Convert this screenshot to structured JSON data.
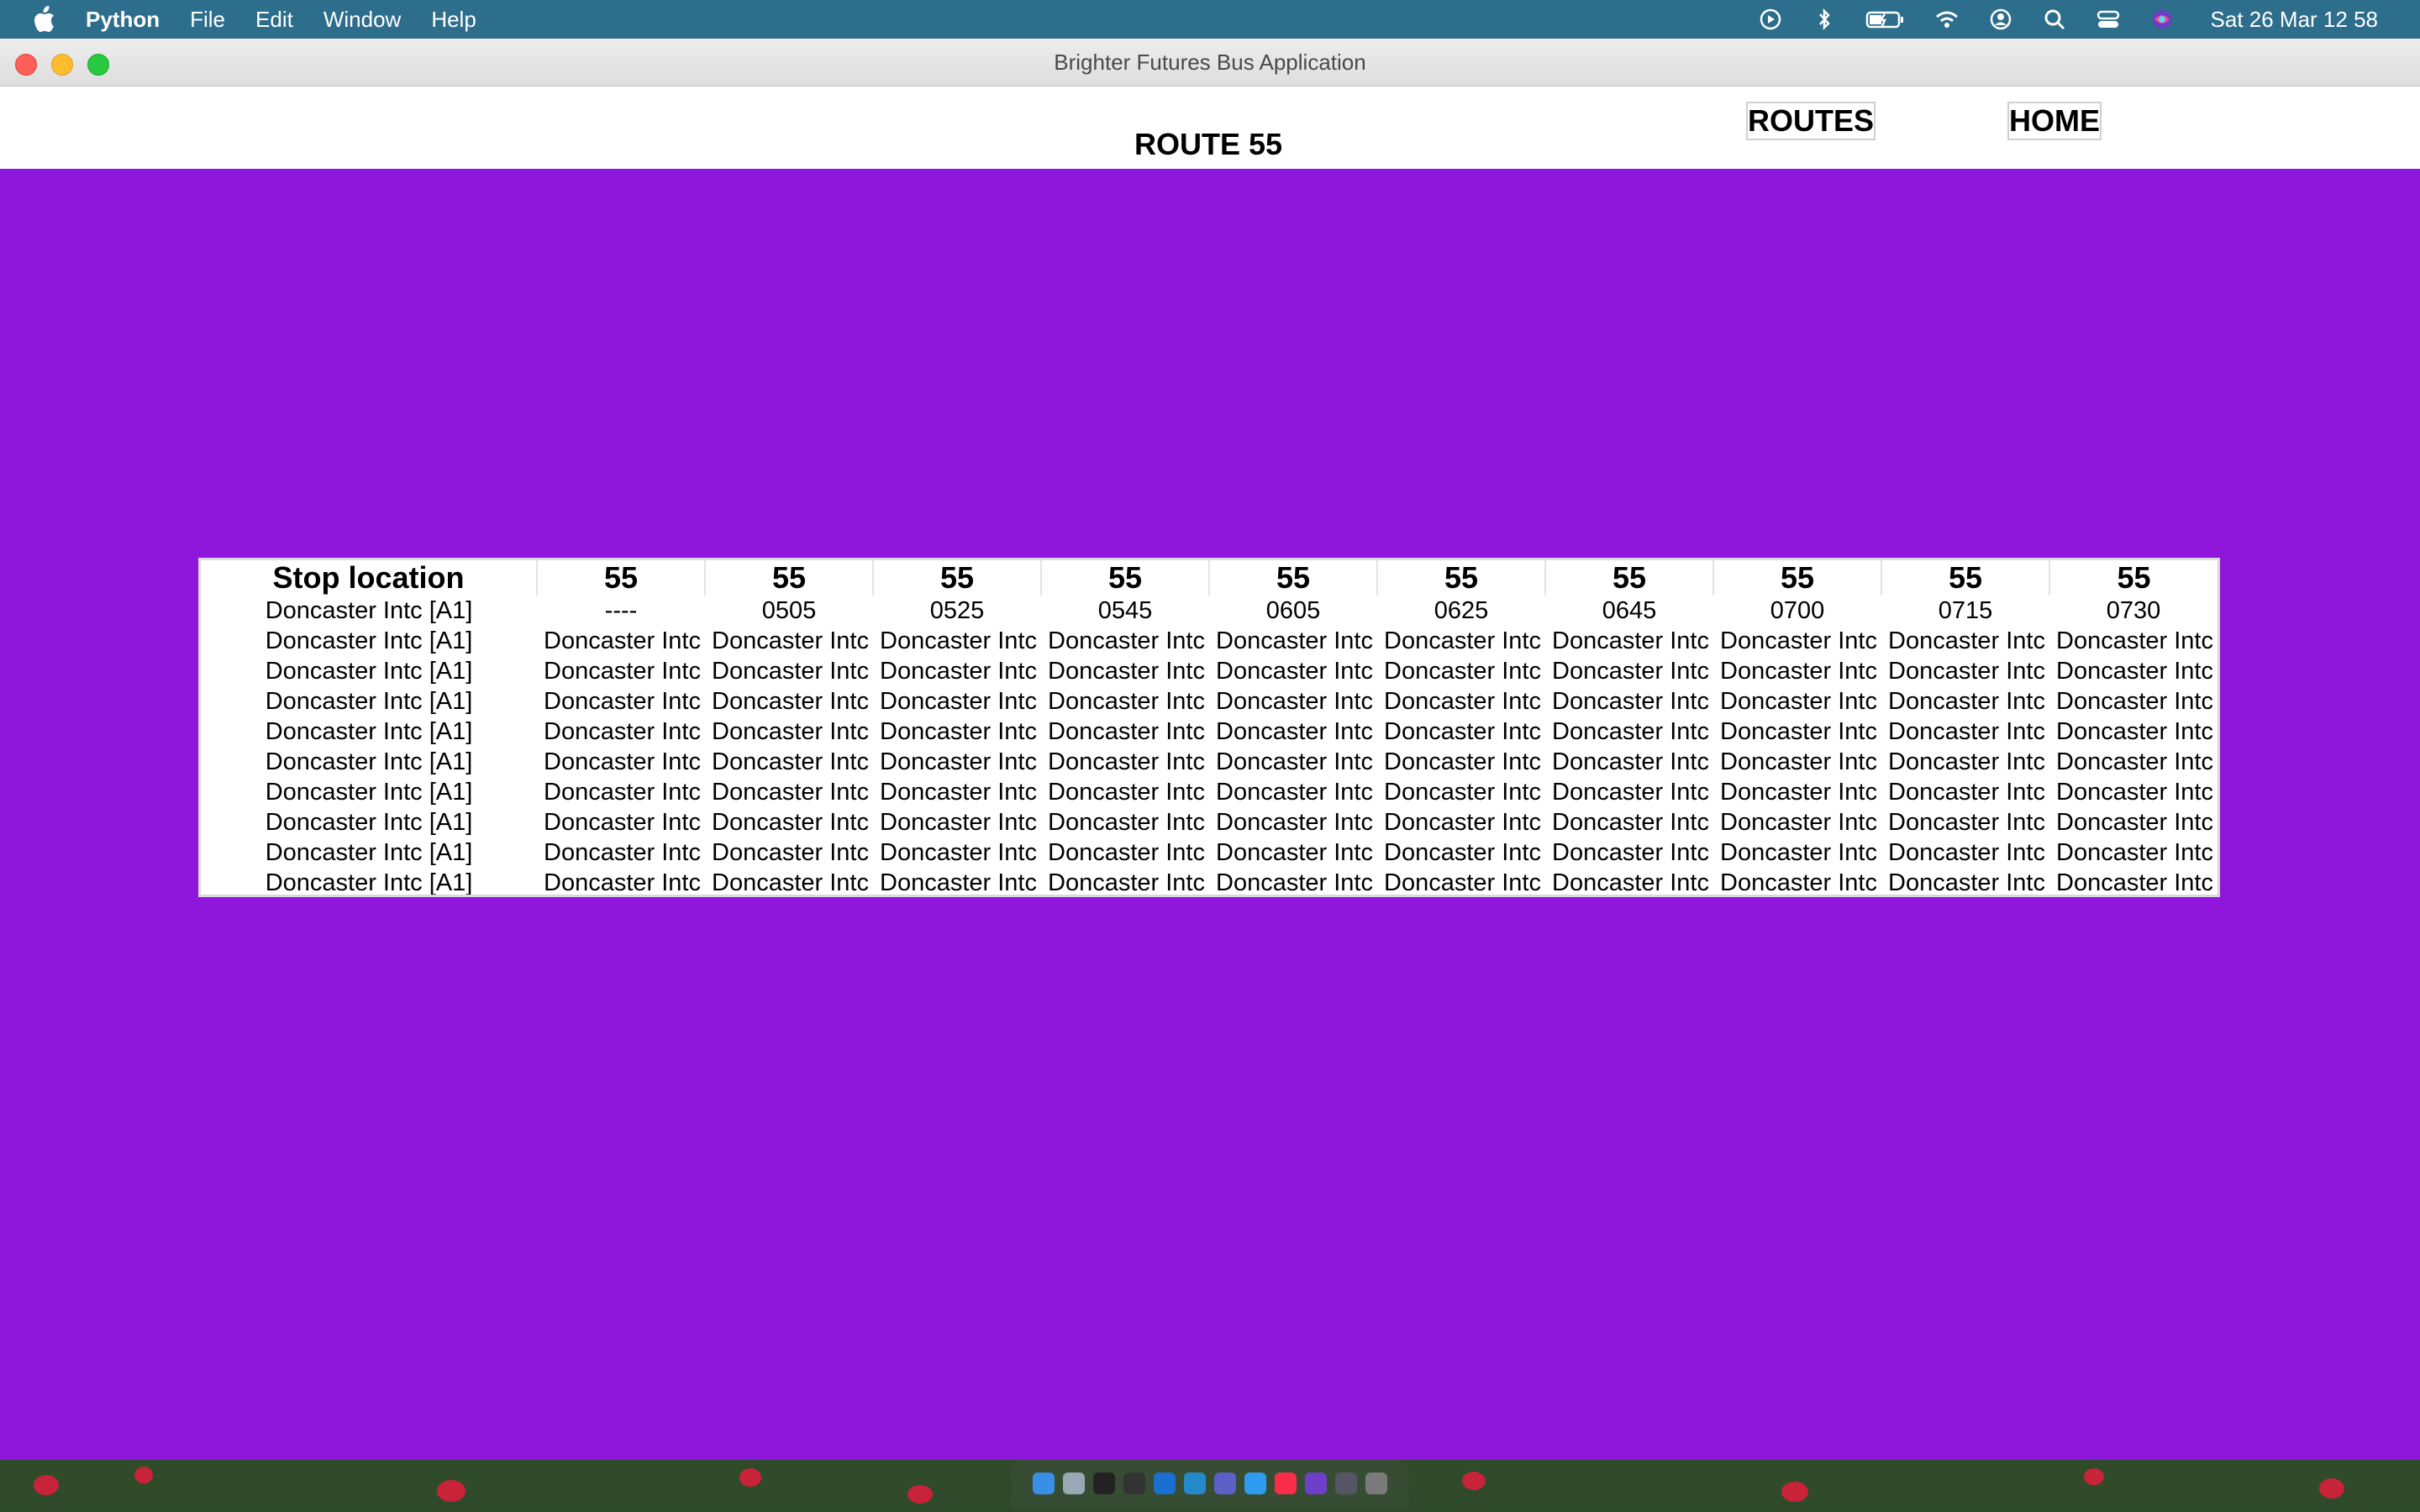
{
  "menubar": {
    "app_name": "Python",
    "items": [
      "File",
      "Edit",
      "Window",
      "Help"
    ],
    "clock": "Sat 26 Mar  12 58"
  },
  "window": {
    "title": "Brighter Futures Bus Application"
  },
  "header": {
    "page_title": "ROUTE 55",
    "routes_button": "ROUTES",
    "home_button": "HOME"
  },
  "timetable": {
    "columns": [
      "Stop location",
      "55",
      "55",
      "55",
      "55",
      "55",
      "55",
      "55",
      "55",
      "55",
      "55"
    ],
    "rows": [
      [
        "Doncaster Intc [A1]",
        "----",
        "0505",
        "0525",
        "0545",
        "0605",
        "0625",
        "0645",
        "0700",
        "0715",
        "0730"
      ],
      [
        "Doncaster Intc [A1]",
        "Doncaster Intc",
        "Doncaster Intc",
        "Doncaster Intc",
        "Doncaster Intc",
        "Doncaster Intc",
        "Doncaster Intc",
        "Doncaster Intc",
        "Doncaster Intc",
        "Doncaster Intc",
        "Doncaster Intc"
      ],
      [
        "Doncaster Intc [A1]",
        "Doncaster Intc",
        "Doncaster Intc",
        "Doncaster Intc",
        "Doncaster Intc",
        "Doncaster Intc",
        "Doncaster Intc",
        "Doncaster Intc",
        "Doncaster Intc",
        "Doncaster Intc",
        "Doncaster Intc"
      ],
      [
        "Doncaster Intc [A1]",
        "Doncaster Intc",
        "Doncaster Intc",
        "Doncaster Intc",
        "Doncaster Intc",
        "Doncaster Intc",
        "Doncaster Intc",
        "Doncaster Intc",
        "Doncaster Intc",
        "Doncaster Intc",
        "Doncaster Intc"
      ],
      [
        "Doncaster Intc [A1]",
        "Doncaster Intc",
        "Doncaster Intc",
        "Doncaster Intc",
        "Doncaster Intc",
        "Doncaster Intc",
        "Doncaster Intc",
        "Doncaster Intc",
        "Doncaster Intc",
        "Doncaster Intc",
        "Doncaster Intc"
      ],
      [
        "Doncaster Intc [A1]",
        "Doncaster Intc",
        "Doncaster Intc",
        "Doncaster Intc",
        "Doncaster Intc",
        "Doncaster Intc",
        "Doncaster Intc",
        "Doncaster Intc",
        "Doncaster Intc",
        "Doncaster Intc",
        "Doncaster Intc"
      ],
      [
        "Doncaster Intc [A1]",
        "Doncaster Intc",
        "Doncaster Intc",
        "Doncaster Intc",
        "Doncaster Intc",
        "Doncaster Intc",
        "Doncaster Intc",
        "Doncaster Intc",
        "Doncaster Intc",
        "Doncaster Intc",
        "Doncaster Intc"
      ],
      [
        "Doncaster Intc [A1]",
        "Doncaster Intc",
        "Doncaster Intc",
        "Doncaster Intc",
        "Doncaster Intc",
        "Doncaster Intc",
        "Doncaster Intc",
        "Doncaster Intc",
        "Doncaster Intc",
        "Doncaster Intc",
        "Doncaster Intc"
      ],
      [
        "Doncaster Intc [A1]",
        "Doncaster Intc",
        "Doncaster Intc",
        "Doncaster Intc",
        "Doncaster Intc",
        "Doncaster Intc",
        "Doncaster Intc",
        "Doncaster Intc",
        "Doncaster Intc",
        "Doncaster Intc",
        "Doncaster Intc"
      ],
      [
        "Doncaster Intc [A1]",
        "Doncaster Intc",
        "Doncaster Intc",
        "Doncaster Intc",
        "Doncaster Intc",
        "Doncaster Intc",
        "Doncaster Intc",
        "Doncaster Intc",
        "Doncaster Intc",
        "Doncaster Intc",
        "Doncaster Intc"
      ]
    ]
  },
  "colors": {
    "menubar_bg": "#2d6e8c",
    "window_bg": "#8f17dc",
    "header_bg": "#ffffff"
  },
  "status_icons": [
    "play-circle-icon",
    "bluetooth-icon",
    "battery-charging-icon",
    "wifi-icon",
    "user-circle-icon",
    "search-icon",
    "control-center-icon",
    "siri-icon"
  ]
}
